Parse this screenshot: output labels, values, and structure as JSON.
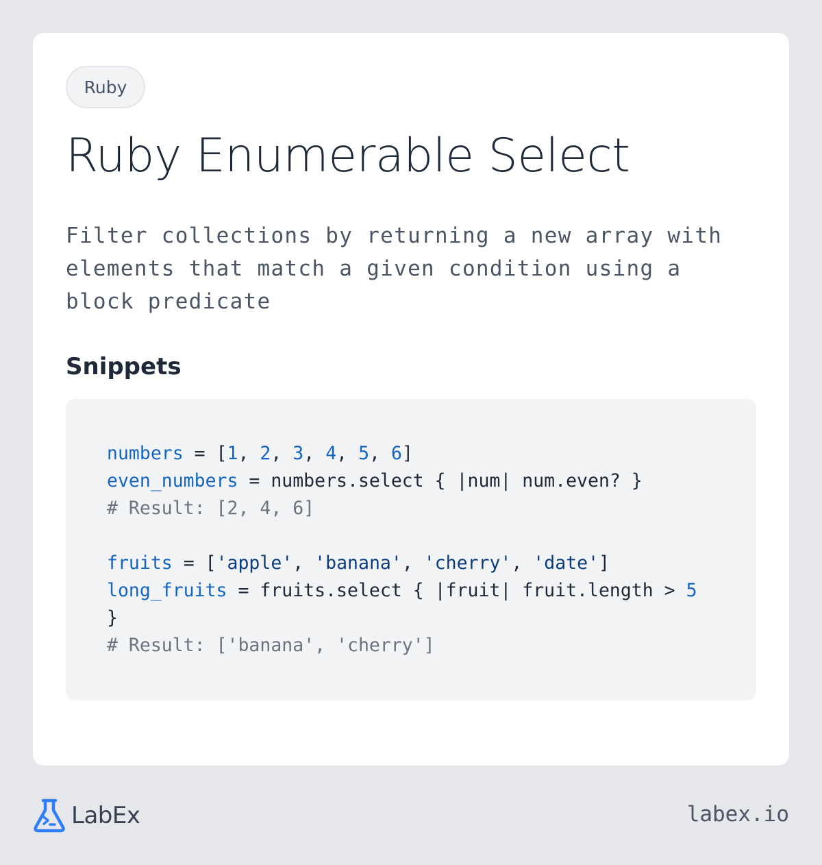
{
  "tag": "Ruby",
  "title": "Ruby Enumerable Select",
  "description": "Filter collections by returning a new array with elements that match a given condition using a block predicate",
  "section_title": "Snippets",
  "code_lines": [
    [
      {
        "t": "numbers",
        "k": "var"
      },
      {
        "t": " = [",
        "k": "plain"
      },
      {
        "t": "1",
        "k": "num"
      },
      {
        "t": ", ",
        "k": "plain"
      },
      {
        "t": "2",
        "k": "num"
      },
      {
        "t": ", ",
        "k": "plain"
      },
      {
        "t": "3",
        "k": "num"
      },
      {
        "t": ", ",
        "k": "plain"
      },
      {
        "t": "4",
        "k": "num"
      },
      {
        "t": ", ",
        "k": "plain"
      },
      {
        "t": "5",
        "k": "num"
      },
      {
        "t": ", ",
        "k": "plain"
      },
      {
        "t": "6",
        "k": "num"
      },
      {
        "t": "]",
        "k": "plain"
      }
    ],
    [
      {
        "t": "even_numbers",
        "k": "var"
      },
      {
        "t": " = numbers.select { |num| num.even? }",
        "k": "plain"
      }
    ],
    [
      {
        "t": "# Result: [2, 4, 6]",
        "k": "cmt"
      }
    ],
    [],
    [
      {
        "t": "fruits",
        "k": "var"
      },
      {
        "t": " = [",
        "k": "plain"
      },
      {
        "t": "'apple'",
        "k": "str"
      },
      {
        "t": ", ",
        "k": "plain"
      },
      {
        "t": "'banana'",
        "k": "str"
      },
      {
        "t": ", ",
        "k": "plain"
      },
      {
        "t": "'cherry'",
        "k": "str"
      },
      {
        "t": ", ",
        "k": "plain"
      },
      {
        "t": "'date'",
        "k": "str"
      },
      {
        "t": "]",
        "k": "plain"
      }
    ],
    [
      {
        "t": "long_fruits",
        "k": "var"
      },
      {
        "t": " = fruits.select { |fruit| fruit.length > ",
        "k": "plain"
      },
      {
        "t": "5",
        "k": "num"
      }
    ],
    [
      {
        "t": "}",
        "k": "plain"
      }
    ],
    [
      {
        "t": "# Result: ['banana', 'cherry']",
        "k": "cmt"
      }
    ]
  ],
  "footer": {
    "logo_icon": "flask-terminal-icon",
    "logo_text": "LabEx",
    "url": "labex.io"
  },
  "colors": {
    "background": "#e5e7eb",
    "card": "#ffffff",
    "accent": "#2d7ff9",
    "code_variable": "#1565c0",
    "code_comment": "#6b7280"
  }
}
